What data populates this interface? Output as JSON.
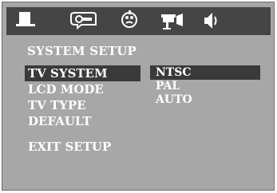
{
  "icon_bar": {
    "tabs": [
      {
        "icon": "tv-monitor-icon",
        "active": true
      },
      {
        "icon": "speech-bubble-icon",
        "active": false
      },
      {
        "icon": "dolby-surround-icon",
        "active": false
      },
      {
        "icon": "video-camera-icon",
        "active": false
      },
      {
        "icon": "speaker-icon",
        "active": false
      }
    ]
  },
  "page": {
    "title": "SYSTEM SETUP"
  },
  "menu": {
    "items": [
      {
        "label": "TV SYSTEM",
        "selected": true
      },
      {
        "label": "LCD MODE",
        "selected": false
      },
      {
        "label": "TV TYPE",
        "selected": false
      },
      {
        "label": "DEFAULT",
        "selected": false
      },
      {
        "label": "EXIT SETUP",
        "selected": false
      }
    ]
  },
  "options": {
    "items": [
      {
        "label": "NTSC",
        "selected": true
      },
      {
        "label": "PAL",
        "selected": false
      },
      {
        "label": "AUTO",
        "selected": false
      }
    ]
  },
  "colors": {
    "panel": "#a7a7a7",
    "bar": "#454545",
    "highlight": "#3a3a3a",
    "text": "#ffffff"
  }
}
